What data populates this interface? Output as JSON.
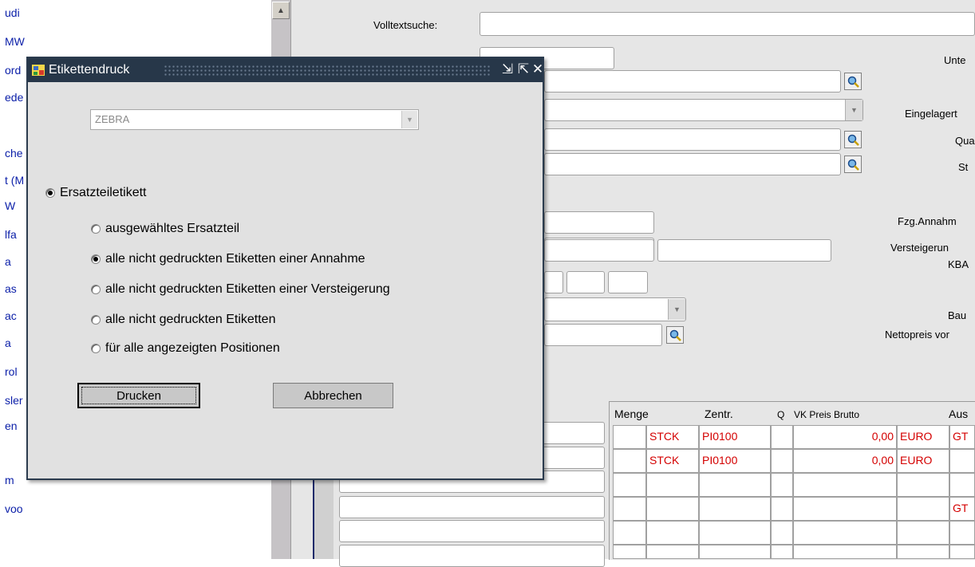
{
  "left_list": [
    "udi",
    "MW",
    "ord",
    "ede",
    "",
    "che",
    "t (M",
    "W",
    "lfa",
    "a",
    "as",
    "ac",
    "a",
    "rol",
    "sler",
    "en",
    "",
    "m",
    "voo"
  ],
  "main": {
    "fulltext_label": "Volltextsuche:",
    "right_labels": [
      "Unte",
      "Eingelagert",
      "Qua",
      "St",
      "Fzg.Annahm",
      "Versteigerun",
      "KBA",
      "Bau",
      "Nettopreis vor"
    ]
  },
  "grid": {
    "headers": {
      "menge": "Menge",
      "zentr": "Zentr.",
      "q": "Q",
      "vk": "VK Preis Brutto",
      "aus": "Aus"
    },
    "rows": [
      {
        "unit": "STCK",
        "code": "PI0100",
        "price": "0,00",
        "currency": "EURO",
        "extra": "GT"
      },
      {
        "unit": "STCK",
        "code": "PI0100",
        "price": "0,00",
        "currency": "EURO",
        "extra": ""
      }
    ],
    "row4_extra": "GT"
  },
  "dialog": {
    "title": "Etikettendruck",
    "printer": "ZEBRA",
    "main_option": "Ersatzteiletikett",
    "options": [
      {
        "label": "ausgewähltes Ersatzteil",
        "checked": false
      },
      {
        "label": "alle nicht gedruckten Etiketten einer Annahme",
        "checked": true
      },
      {
        "label": "alle nicht gedruckten Etiketten einer Versteigerung",
        "checked": false
      },
      {
        "label": "alle nicht gedruckten Etiketten",
        "checked": false
      },
      {
        "label": "für alle angezeigten Positionen",
        "checked": false
      }
    ],
    "print_label": "Drucken",
    "cancel_label": "Abbrechen"
  },
  "colors": {
    "titlebar": "#273749",
    "list_text": "#0a1ea8",
    "grid_text": "#d40000"
  }
}
